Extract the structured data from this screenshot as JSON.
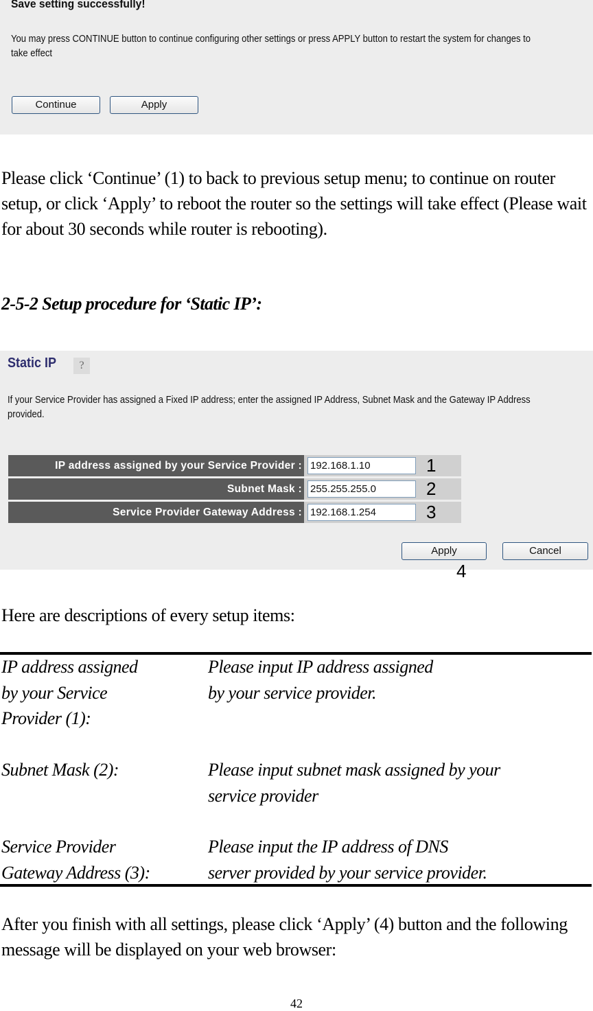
{
  "save_panel": {
    "title": "Save setting successfully!",
    "message": "You may press CONTINUE button to continue configuring other settings or press APPLY button to restart the system for changes to take effect",
    "buttons": {
      "continue": "Continue",
      "apply": "Apply"
    }
  },
  "paragraph_continue": "Please click ‘Continue’ (1) to back to previous setup menu; to continue on router setup, or click ‘Apply’ to reboot the router so the settings will take effect (Please wait for about 30 seconds while router is rebooting).",
  "section_heading": "2-5-2 Setup procedure for ‘Static IP’:",
  "static_panel": {
    "title": "Static IP",
    "help_icon": "help-question-icon",
    "description": "If your Service Provider has assigned a Fixed IP address; enter the assigned IP Address, Subnet Mask and the Gateway IP Address provided.",
    "fields": [
      {
        "label": "IP address assigned by your Service Provider :",
        "value": "192.168.1.10",
        "marker": "1"
      },
      {
        "label": "Subnet Mask :",
        "value": "255.255.255.0",
        "marker": "2"
      },
      {
        "label": "Service Provider Gateway Address :",
        "value": "192.168.1.254",
        "marker": "3"
      }
    ],
    "buttons": {
      "apply": "Apply",
      "cancel": "Cancel"
    },
    "apply_marker": "4"
  },
  "paragraph_descriptions_intro": "Here are descriptions of every setup items:",
  "descriptions": [
    {
      "term": "IP address assigned\nby your Service\nProvider (1):",
      "definition": "Please input IP address assigned\nby your service provider."
    },
    {
      "term": "Subnet Mask (2):",
      "definition": "Please input subnet mask assigned by your\nservice provider"
    },
    {
      "term": "Service Provider\nGateway Address (3):",
      "definition": "Please input the IP address of DNS\nserver provided by your service provider."
    }
  ],
  "paragraph_final": "After you finish with all settings, please click ‘Apply’ (4) button and the following message will be displayed on your web browser:",
  "page_number": "42"
}
